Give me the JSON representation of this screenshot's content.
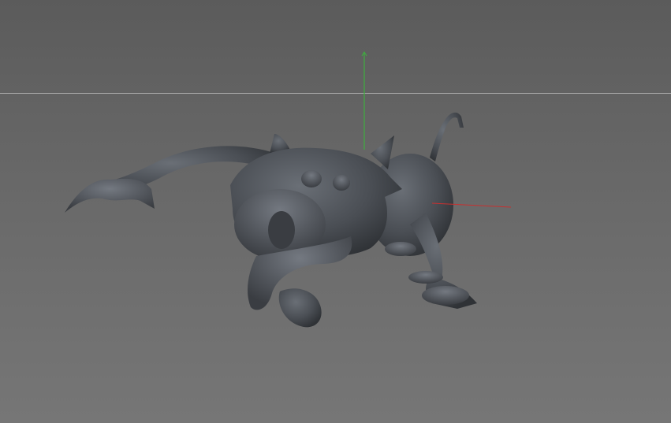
{
  "viewport": {
    "background_top": "#5b5b5b",
    "background_bottom": "#767676",
    "horizon_color": "#a8a8a8",
    "axis_y_color": "#3fae3f",
    "axis_x_color": "#c83030",
    "model_color": "#4a4e54"
  }
}
